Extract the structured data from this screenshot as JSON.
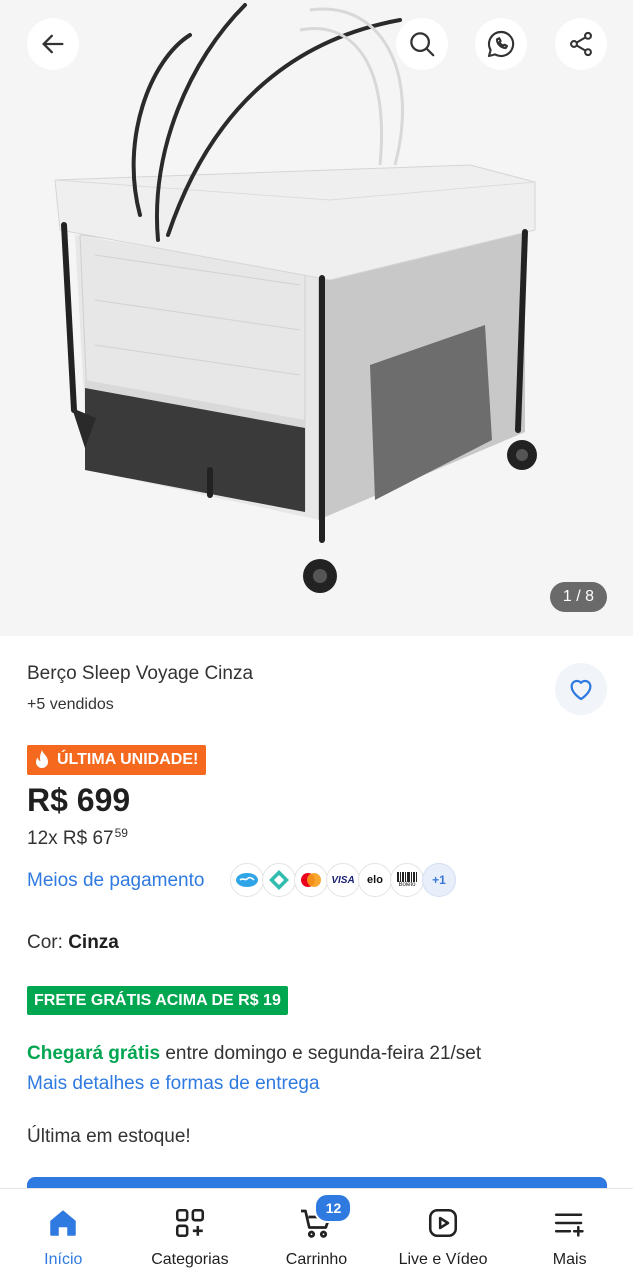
{
  "hero": {
    "image_counter": "1 / 8",
    "icons": [
      "back-arrow-icon",
      "search-icon",
      "whatsapp-icon",
      "share-icon"
    ]
  },
  "product": {
    "title": "Berço Sleep Voyage Cinza",
    "sold": "+5 vendidos",
    "badge": "ÚLTIMA UNIDADE!",
    "price": "R$ 699",
    "installment_prefix": "12x R$ 67",
    "installment_cents": "59",
    "payment_link": "Meios de pagamento",
    "payment_more": "+1",
    "color_label": "Cor: ",
    "color_value": "Cinza",
    "free_shipping_badge": "FRETE GRÁTIS ACIMA DE R$ 19",
    "delivery_highlight": "Chegará grátis",
    "delivery_rest": " entre domingo e segunda-feira 21/set",
    "delivery_more_link": "Mais detalhes e formas de entrega",
    "stock": "Última em estoque!"
  },
  "payment_methods": {
    "visa": "VISA",
    "elo": "elo",
    "boleto": "Boleto"
  },
  "tabbar": {
    "home": "Início",
    "categories": "Categorias",
    "cart": "Carrinho",
    "cart_count": "12",
    "live": "Live e Vídeo",
    "more": "Mais"
  },
  "colors": {
    "accent": "#2f7ae0",
    "green": "#00a650",
    "orange": "#f5691f"
  }
}
